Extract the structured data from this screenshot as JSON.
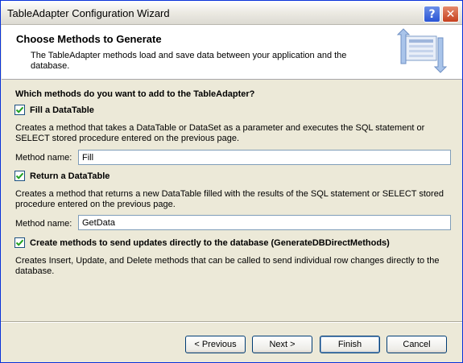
{
  "window": {
    "title": "TableAdapter Configuration Wizard",
    "help_label": "?",
    "close_label": "✕"
  },
  "header": {
    "title": "Choose Methods to Generate",
    "description": "The TableAdapter methods load and save data between your application and the database."
  },
  "main": {
    "question": "Which methods do you want to add to the TableAdapter?",
    "fill": {
      "checked": true,
      "label": "Fill a DataTable",
      "description": "Creates a method that takes a DataTable or DataSet as a parameter and executes the SQL statement or SELECT stored procedure entered on the previous page.",
      "method_name_label": "Method name:",
      "method_name_value": "Fill"
    },
    "return": {
      "checked": true,
      "label": "Return a DataTable",
      "description": "Creates a method that returns a new DataTable filled with the results of the SQL statement or SELECT stored procedure entered on the previous page.",
      "method_name_label": "Method name:",
      "method_name_value": "GetData"
    },
    "direct": {
      "checked": true,
      "label": "Create methods to send updates directly to the database (GenerateDBDirectMethods)",
      "description": "Creates Insert, Update, and Delete methods that can be called to send individual row changes directly to the database."
    }
  },
  "footer": {
    "previous_label": "< Previous",
    "next_label": "Next >",
    "finish_label": "Finish",
    "cancel_label": "Cancel"
  },
  "colors": {
    "checkmark": "#21a121",
    "window_bg": "#ece9d8"
  }
}
